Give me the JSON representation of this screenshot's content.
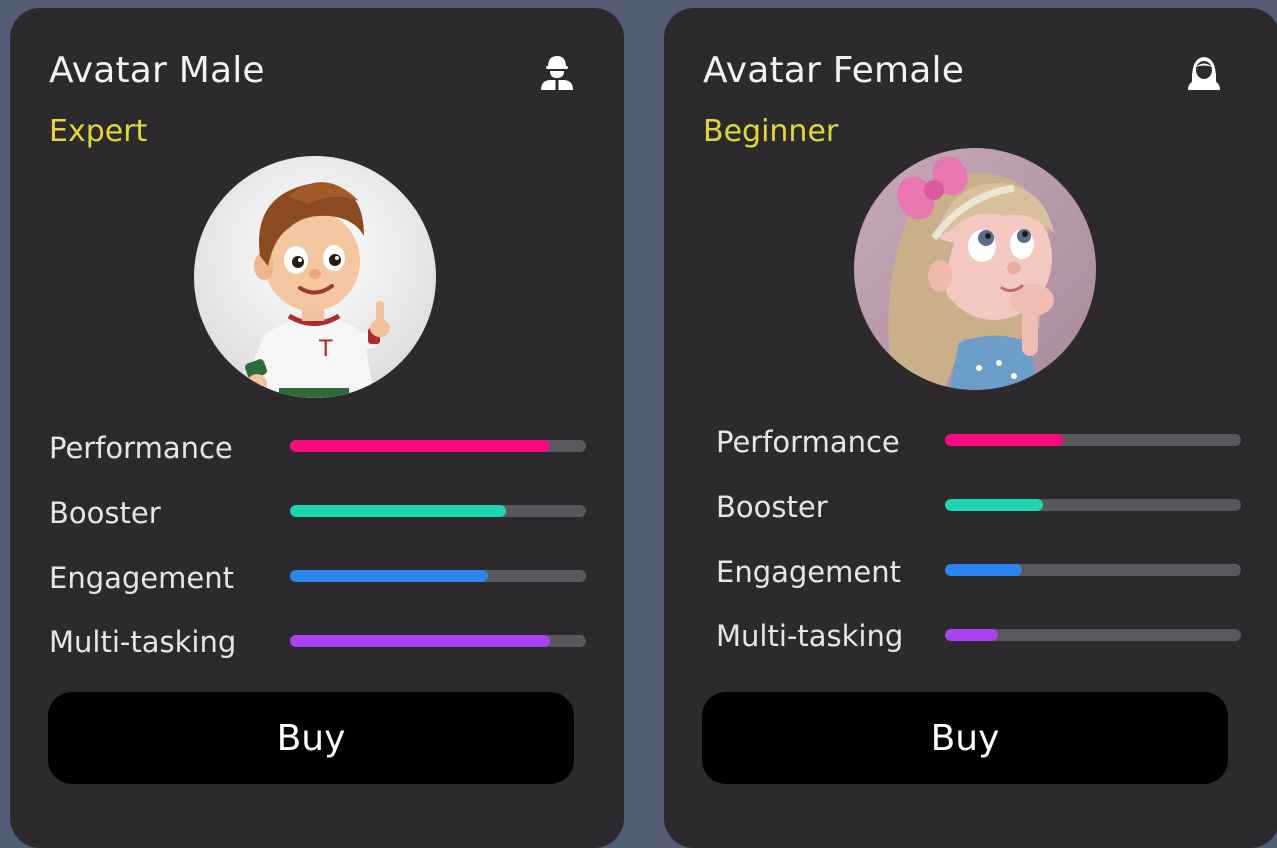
{
  "colors": {
    "background": "#525c74",
    "card": "#2c2a2d",
    "level_text": "#e1d63a",
    "track": "#5a585c",
    "button": "#000000"
  },
  "cards": [
    {
      "title": "Avatar Male",
      "level": "Expert",
      "icon": "male-user-icon",
      "avatar": "boy-avatar-thumbs-up",
      "button_label": "Buy",
      "stats": [
        {
          "label": "Performance",
          "value": 0.88,
          "color": "#fb0a7f"
        },
        {
          "label": "Booster",
          "value": 0.73,
          "color": "#1ed7b0"
        },
        {
          "label": "Engagement",
          "value": 0.67,
          "color": "#2c86f0"
        },
        {
          "label": "Multi-tasking",
          "value": 0.88,
          "color": "#a743f0"
        }
      ]
    },
    {
      "title": "Avatar Female",
      "level": "Beginner",
      "icon": "female-user-icon",
      "avatar": "girl-avatar-pink-bow",
      "button_label": "Buy",
      "stats": [
        {
          "label": "Performance",
          "value": 0.4,
          "color": "#fb0a7f"
        },
        {
          "label": "Booster",
          "value": 0.33,
          "color": "#1ed7b0"
        },
        {
          "label": "Engagement",
          "value": 0.26,
          "color": "#2c86f0"
        },
        {
          "label": "Multi-tasking",
          "value": 0.18,
          "color": "#a743f0"
        }
      ]
    }
  ]
}
